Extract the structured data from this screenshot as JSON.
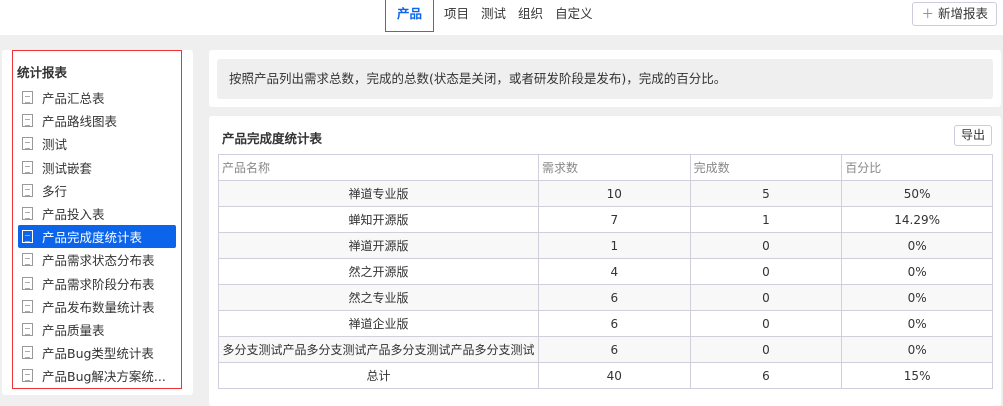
{
  "nav": {
    "tabs": [
      "产品",
      "项目",
      "测试",
      "组织",
      "自定义"
    ],
    "add_label": "新增报表",
    "add_icon": "plus-icon"
  },
  "sidebar": {
    "title": "统计报表",
    "items": [
      "产品汇总表",
      "产品路线图表",
      "测试",
      "测试嵌套",
      "多行",
      "产品投入表",
      "产品完成度统计表",
      "产品需求状态分布表",
      "产品需求阶段分布表",
      "产品发布数量统计表",
      "产品质量表",
      "产品Bug类型统计表",
      "产品Bug解决方案统..."
    ],
    "selected": 6
  },
  "description": "按照产品列出需求总数，完成的总数(状态是关闭，或者研发阶段是发布)，完成的百分比。",
  "report": {
    "title": "产品完成度统计表",
    "export_label": "导出",
    "columns": [
      "产品名称",
      "需求数",
      "完成数",
      "百分比"
    ],
    "rows": [
      [
        "禅道专业版",
        "10",
        "5",
        "50%"
      ],
      [
        "蝉知开源版",
        "7",
        "1",
        "14.29%"
      ],
      [
        "禅道开源版",
        "1",
        "0",
        "0%"
      ],
      [
        "然之开源版",
        "4",
        "0",
        "0%"
      ],
      [
        "然之专业版",
        "6",
        "0",
        "0%"
      ],
      [
        "禅道企业版",
        "6",
        "0",
        "0%"
      ],
      [
        "多分支测试产品多分支测试产品多分支测试产品多分支测试",
        "6",
        "0",
        "0%"
      ],
      [
        "总计",
        "40",
        "6",
        "15%"
      ]
    ]
  },
  "colors": {
    "accent": "#0c64eb",
    "highlight_border": "#ee3333"
  }
}
